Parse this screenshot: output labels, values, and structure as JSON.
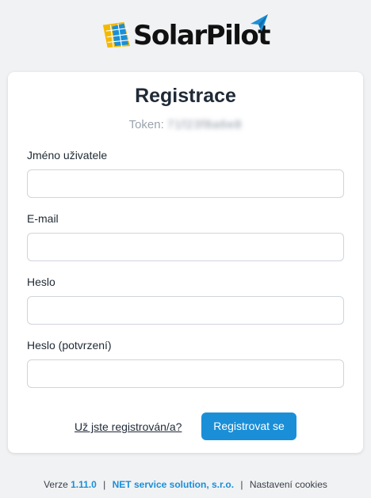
{
  "brand": {
    "name": "SolarPilot",
    "accent": "#1a8fd8"
  },
  "form": {
    "title": "Registrace",
    "token_label": "Token:",
    "token_value": "71f23f8a6e8",
    "fields": [
      {
        "label": "Jméno uživatele",
        "value": ""
      },
      {
        "label": "E-mail",
        "value": ""
      },
      {
        "label": "Heslo",
        "value": ""
      },
      {
        "label": "Heslo (potvrzení)",
        "value": ""
      }
    ],
    "login_link": "Už jste registrován/a?",
    "submit_label": "Registrovat se"
  },
  "footer": {
    "version_label": "Verze",
    "version": "1.11.0",
    "company": "NET service solution, s.r.o.",
    "cookies": "Nastavení cookies"
  }
}
